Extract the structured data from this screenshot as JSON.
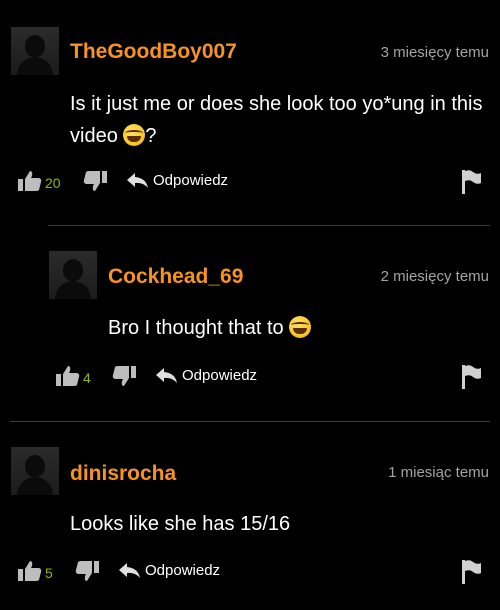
{
  "comments": [
    {
      "username": "TheGoodBoy007",
      "time": "3 miesięcy temu",
      "text_line1": "Is it just me or does she look too yo*ung in this",
      "text_line2": "video",
      "text_line2_suffix": "?",
      "likes": "20",
      "reply_label": "Odpowiedz"
    },
    {
      "username": "Cockhead_69",
      "time": "2 miesięcy temu",
      "text_line1": "Bro I thought that to",
      "likes": "4",
      "reply_label": "Odpowiedz"
    },
    {
      "username": "dinisrocha",
      "time": "1 miesiąc temu",
      "text_line1": "Looks like she has 15/16",
      "likes": "5",
      "reply_label": "Odpowiedz"
    }
  ],
  "icons": {
    "avatar": "default-avatar-icon",
    "like": "thumbs-up-icon",
    "dislike": "thumbs-down-icon",
    "reply": "reply-arrow-icon",
    "flag": "flag-icon",
    "emoji": "laughing-emoji"
  },
  "colors": {
    "background": "#000000",
    "username": "#f7931e",
    "timestamp": "#a3a3a3",
    "like_count": "#9ab300",
    "divider": "#3b3b3b"
  }
}
